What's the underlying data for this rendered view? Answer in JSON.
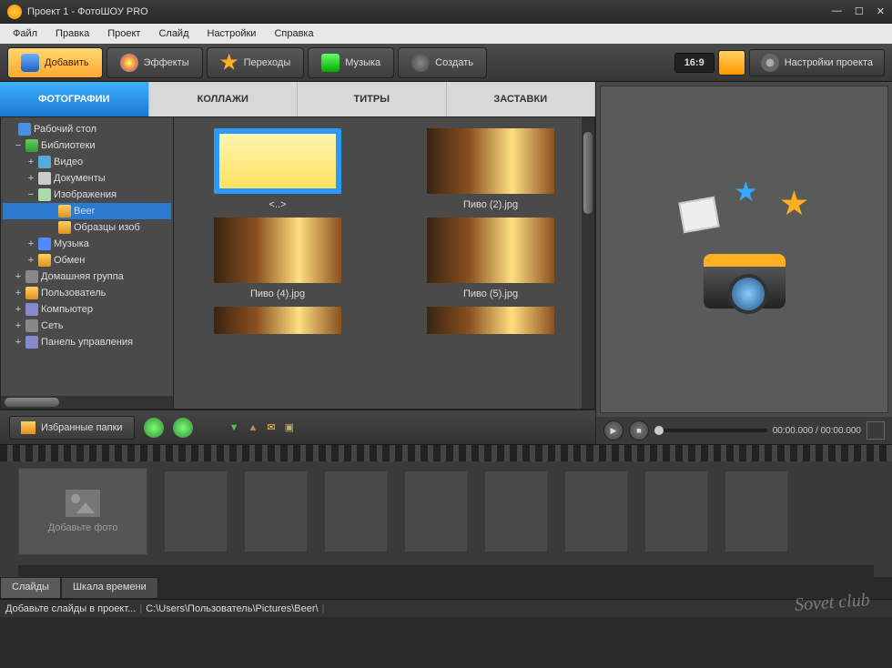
{
  "title": "Проект 1 - ФотоШОУ PRO",
  "menu": [
    "Файл",
    "Правка",
    "Проект",
    "Слайд",
    "Настройки",
    "Справка"
  ],
  "toolbar": {
    "add": "Добавить",
    "effects": "Эффекты",
    "transitions": "Переходы",
    "music": "Музыка",
    "create": "Создать",
    "aspect": "16:9",
    "project_settings": "Настройки проекта"
  },
  "tabs": {
    "photos": "ФОТОГРАФИИ",
    "collages": "КОЛЛАЖИ",
    "titles": "ТИТРЫ",
    "intros": "ЗАСТАВКИ"
  },
  "tree": {
    "desktop": "Рабочий стол",
    "libraries": "Библиотеки",
    "video": "Видео",
    "documents": "Документы",
    "images": "Изображения",
    "beer": "Beer",
    "samples": "Образцы изоб",
    "music": "Музыка",
    "exchange": "Обмен",
    "homegroup": "Домашняя группа",
    "user": "Пользователь",
    "computer": "Компьютер",
    "network": "Сеть",
    "control": "Панель управления"
  },
  "thumbs": {
    "nav": "<..>",
    "f2": "Пиво (2).jpg",
    "f4": "Пиво (4).jpg",
    "f5": "Пиво (5).jpg"
  },
  "favorites": "Избранные папки",
  "player": {
    "time": "00:00.000 / 00:00.000"
  },
  "timeline": {
    "add_photo": "Добавьте фото",
    "slides_tab": "Слайды",
    "timescale_tab": "Шкала времени"
  },
  "status": {
    "hint": "Добавьте слайды в проект...",
    "path": "C:\\Users\\Пользователь\\Pictures\\Beer\\"
  },
  "watermark": "Sovet club"
}
